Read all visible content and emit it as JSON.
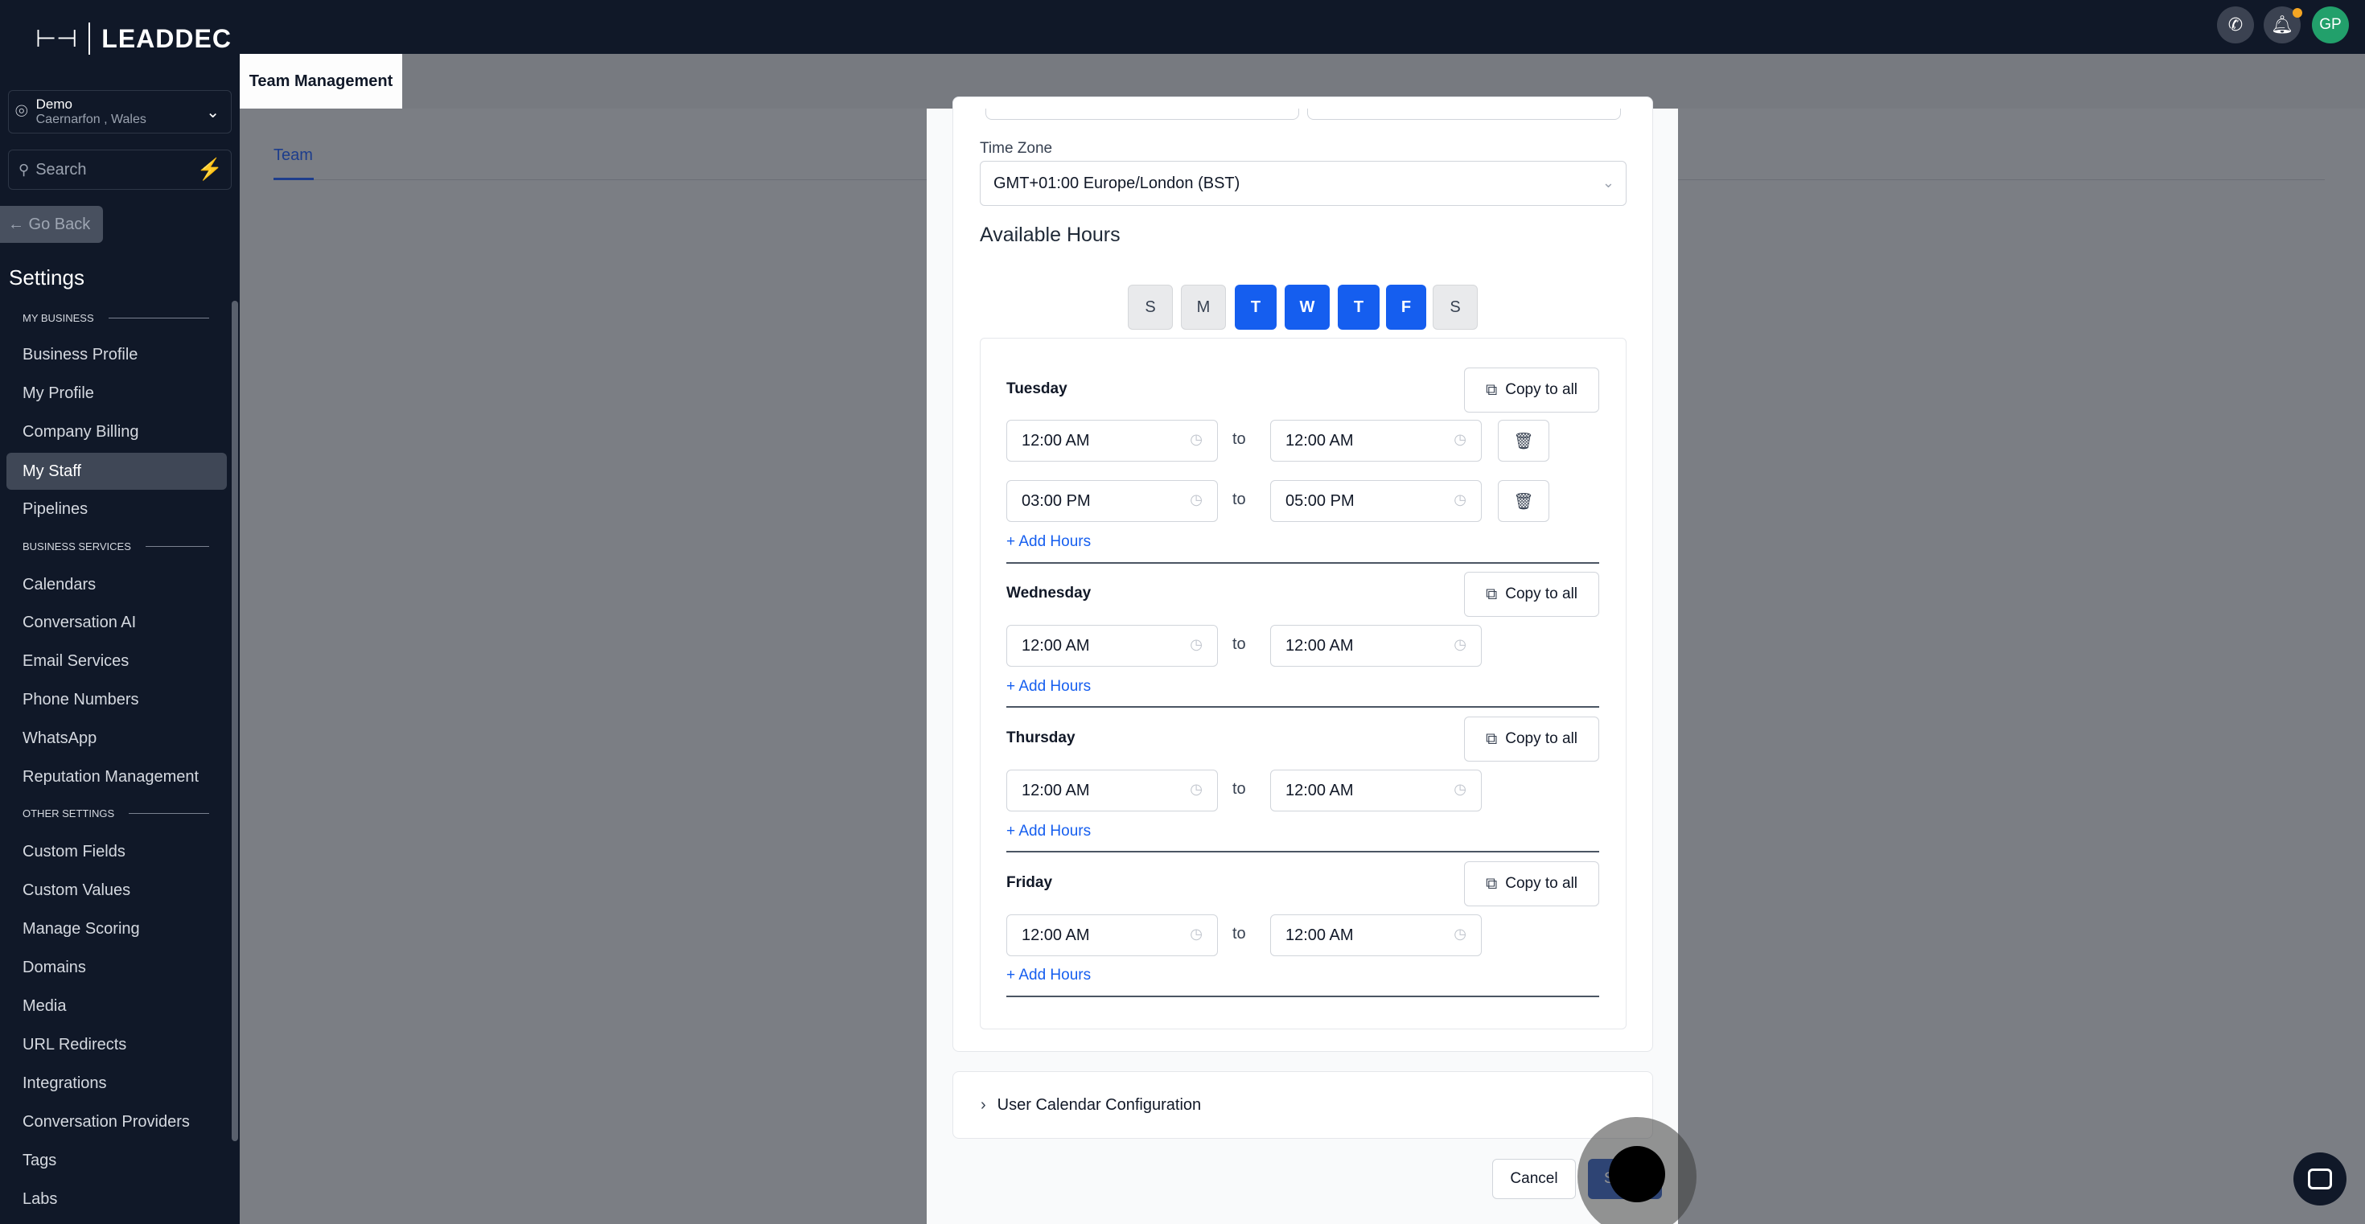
{
  "brand": {
    "logo_mark": "⊢⊣",
    "name": "LEADDEC"
  },
  "location": {
    "name": "Demo",
    "address": "Caernarfon , Wales"
  },
  "search": {
    "placeholder": "Search"
  },
  "go_back": "← Go Back",
  "settings_title": "Settings",
  "sections": {
    "my_business": "MY BUSINESS",
    "business_services": "BUSINESS SERVICES",
    "other_settings": "OTHER SETTINGS"
  },
  "nav": {
    "business_profile": "Business Profile",
    "my_profile": "My Profile",
    "company_billing": "Company Billing",
    "my_staff": "My Staff",
    "pipelines": "Pipelines",
    "calendars": "Calendars",
    "conversation_ai": "Conversation AI",
    "email_services": "Email Services",
    "phone_numbers": "Phone Numbers",
    "whatsapp": "WhatsApp",
    "reputation_management": "Reputation Management",
    "custom_fields": "Custom Fields",
    "custom_values": "Custom Values",
    "manage_scoring": "Manage Scoring",
    "domains": "Domains",
    "media": "Media",
    "url_redirects": "URL Redirects",
    "integrations": "Integrations",
    "conversation_providers": "Conversation Providers",
    "tags": "Tags",
    "labs": "Labs"
  },
  "topbar": {
    "avatar_initials": "GP",
    "accent": "#22a06b"
  },
  "page_tab": "Team Management",
  "team_tab": "Team",
  "form": {
    "timezone_label": "Time Zone",
    "timezone_value": "GMT+01:00 Europe/London (BST)",
    "available_hours": "Available Hours",
    "weekdays": [
      "S",
      "M",
      "T",
      "W",
      "T",
      "F",
      "S"
    ],
    "copy_label": "Copy to all",
    "to_label": "to",
    "add_hours": "+ Add Hours",
    "days": {
      "tuesday": {
        "name": "Tuesday",
        "slots": [
          [
            "12:00 AM",
            "12:00 AM"
          ],
          [
            "03:00 PM",
            "05:00 PM"
          ]
        ]
      },
      "wednesday": {
        "name": "Wednesday",
        "slots": [
          [
            "12:00 AM",
            "12:00 AM"
          ]
        ]
      },
      "thursday": {
        "name": "Thursday",
        "slots": [
          [
            "12:00 AM",
            "12:00 AM"
          ]
        ]
      },
      "friday": {
        "name": "Friday",
        "slots": [
          [
            "12:00 AM",
            "12:00 AM"
          ]
        ]
      }
    },
    "user_calendar_config": "User Calendar Configuration",
    "cancel": "Cancel",
    "save": "S"
  },
  "colors": {
    "primary": "#155eef",
    "sidebar": "#101828"
  }
}
